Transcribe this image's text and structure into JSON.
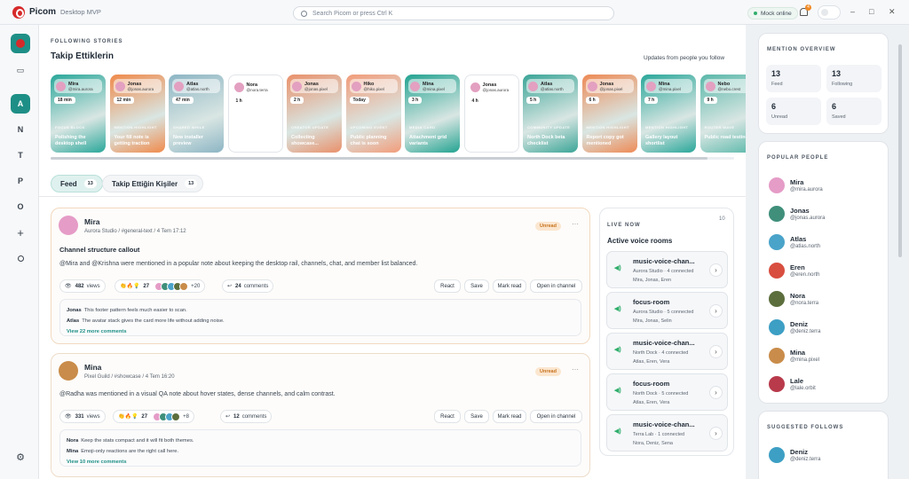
{
  "app": {
    "name": "Picom",
    "subtitle": "Desktop MVP",
    "search_placeholder": "Search Picom or press Ctrl K",
    "status": "Mock online",
    "notifications": "4",
    "win_min": "–",
    "win_max": "□",
    "win_close": "✕"
  },
  "rail": {
    "items": [
      "A",
      "N",
      "T",
      "P",
      "O",
      "+"
    ]
  },
  "stories": {
    "section_label": "FOLLOWING STORIES",
    "title": "Takip Ettiklerin",
    "subtitle": "Updates from people you follow",
    "items": [
      {
        "name": "Mira",
        "handle": "@mira.aurora",
        "time": "18 min",
        "tag": "FOCUS BLOCK",
        "caption": "Polishing the desktop shell",
        "color": "#2aa79a"
      },
      {
        "name": "Jonas",
        "handle": "@jonas.aurora",
        "time": "12 min",
        "tag": "MENTION HIGHLIGHT",
        "caption": "Your fill note is getting traction",
        "color": "#f08a4b"
      },
      {
        "name": "Atlas",
        "handle": "@atlas.north",
        "time": "47 min",
        "tag": "SHARED WHILE",
        "caption": "New installer preview",
        "color": "#8cb5c4"
      },
      {
        "name": "Nora",
        "handle": "@nora.terra",
        "time": "1 h",
        "tag": "",
        "caption": "",
        "color": "#ffffff"
      },
      {
        "name": "Jonas",
        "handle": "@jonas.pixel",
        "time": "2 h",
        "tag": "CREATOR UPDATE",
        "caption": "Collecting showcase...",
        "color": "#e9906a"
      },
      {
        "name": "Hiko",
        "handle": "@hiko.pixel",
        "time": "Today",
        "tag": "UPCOMING EVENT",
        "caption": "Public planning chat is soon",
        "color": "#f29c7a"
      },
      {
        "name": "Mina",
        "handle": "@mina.pixel",
        "time": "3 h",
        "tag": "MEDIA CARD",
        "caption": "Attachment grid variants",
        "color": "#23a391"
      },
      {
        "name": "Jonas",
        "handle": "@jonas.aurora",
        "time": "4 h",
        "tag": "",
        "caption": "",
        "color": "#ffffff"
      },
      {
        "name": "Atlas",
        "handle": "@atlas.north",
        "time": "5 h",
        "tag": "COMMUNITY UPDATE",
        "caption": "North Dock beta checklist",
        "color": "#3ba597"
      },
      {
        "name": "Jonas",
        "handle": "@jonas.pixel",
        "time": "6 h",
        "tag": "MENTION HIGHLIGHT",
        "caption": "Report copy got mentioned",
        "color": "#ee8a55"
      },
      {
        "name": "Mina",
        "handle": "@mina.pixel",
        "time": "7 h",
        "tag": "MENTION HIGHLIGHT",
        "caption": "Gallery layout shortlist",
        "color": "#2aa79a"
      },
      {
        "name": "Nebo",
        "handle": "@nebo.crest",
        "time": "9 h",
        "tag": "ROUTER WAVE",
        "caption": "Public road testing",
        "color": "#5ab8aa"
      }
    ]
  },
  "tabs": [
    {
      "label": "Feed",
      "count": "13"
    },
    {
      "label": "Takip Ettiğin Kişiler",
      "count": "13"
    }
  ],
  "posts": [
    {
      "author": "Mira",
      "meta": "Aurora Studio / #general-text / 4 Tem 17:12",
      "badge": "Unread",
      "title": "Channel structure callout",
      "body": "@Mira and @Krishna were mentioned in a popular note about keeping the desktop rail, channels, chat, and member list balanced.",
      "views": "482",
      "views_label": "views",
      "reactions": "27",
      "more_faces": "+20",
      "comments": "24",
      "comments_label": "comments",
      "actions": [
        "React",
        "Save",
        "Mark read",
        "Open in channel"
      ],
      "thread": [
        {
          "who": "Jonas",
          "text": "This footer pattern feels much easier to scan."
        },
        {
          "who": "Atlas",
          "text": "The avatar stack gives the card more life without adding noise."
        }
      ],
      "view_more": "View 22 more comments"
    },
    {
      "author": "Mina",
      "meta": "Pixel Guild / #showcase / 4 Tem 16:20",
      "badge": "Unread",
      "title": "",
      "body": "@Radha was mentioned in a visual QA note about hover states, dense channels, and calm contrast.",
      "views": "331",
      "views_label": "views",
      "reactions": "27",
      "more_faces": "+8",
      "comments": "12",
      "comments_label": "comments",
      "actions": [
        "React",
        "Save",
        "Mark read",
        "Open in channel"
      ],
      "thread": [
        {
          "who": "Nora",
          "text": "Keep the stats compact and it will fit both themes."
        },
        {
          "who": "Mina",
          "text": "Emoji-only reactions are the right call here."
        }
      ],
      "view_more": "View 10 more comments"
    }
  ],
  "live": {
    "label": "LIVE NOW",
    "count": "10",
    "title": "Active voice rooms",
    "rooms": [
      {
        "name": "music-voice-chan...",
        "server": "Aurora Studio · 4 connected",
        "people": "Mira, Jonas, Eren"
      },
      {
        "name": "focus-room",
        "server": "Aurora Studio · 5 connected",
        "people": "Mira, Jonas, Selin"
      },
      {
        "name": "music-voice-chan...",
        "server": "North Dock · 4 connected",
        "people": "Atlas, Eren, Vera"
      },
      {
        "name": "focus-room",
        "server": "North Dock · 5 connected",
        "people": "Atlas, Eren, Vera"
      },
      {
        "name": "music-voice-chan...",
        "server": "Terra Lab · 1 connected",
        "people": "Nora, Deniz, Sena"
      }
    ]
  },
  "overview": {
    "label": "MENTION OVERVIEW",
    "stats": [
      {
        "value": "13",
        "label": "Feed"
      },
      {
        "value": "13",
        "label": "Following"
      },
      {
        "value": "6",
        "label": "Unread"
      },
      {
        "value": "6",
        "label": "Saved"
      }
    ]
  },
  "popular": {
    "label": "POPULAR PEOPLE",
    "people": [
      {
        "name": "Mira",
        "handle": "@mira.aurora",
        "color": "#e59cc7"
      },
      {
        "name": "Jonas",
        "handle": "@jonas.aurora",
        "color": "#3f8f7b"
      },
      {
        "name": "Atlas",
        "handle": "@atlas.north",
        "color": "#4aa3c9"
      },
      {
        "name": "Eren",
        "handle": "@eren.north",
        "color": "#d84e3f"
      },
      {
        "name": "Nora",
        "handle": "@nora.terra",
        "color": "#5b6e3c"
      },
      {
        "name": "Deniz",
        "handle": "@deniz.terra",
        "color": "#3d9fc4"
      },
      {
        "name": "Mina",
        "handle": "@mina.pixel",
        "color": "#c98c4a"
      },
      {
        "name": "Lale",
        "handle": "@lale.orbit",
        "color": "#b83a4b"
      }
    ]
  },
  "suggested": {
    "label": "SUGGESTED FOLLOWS",
    "people": [
      {
        "name": "Deniz",
        "handle": "@deniz.terra",
        "color": "#3d9fc4"
      }
    ]
  }
}
